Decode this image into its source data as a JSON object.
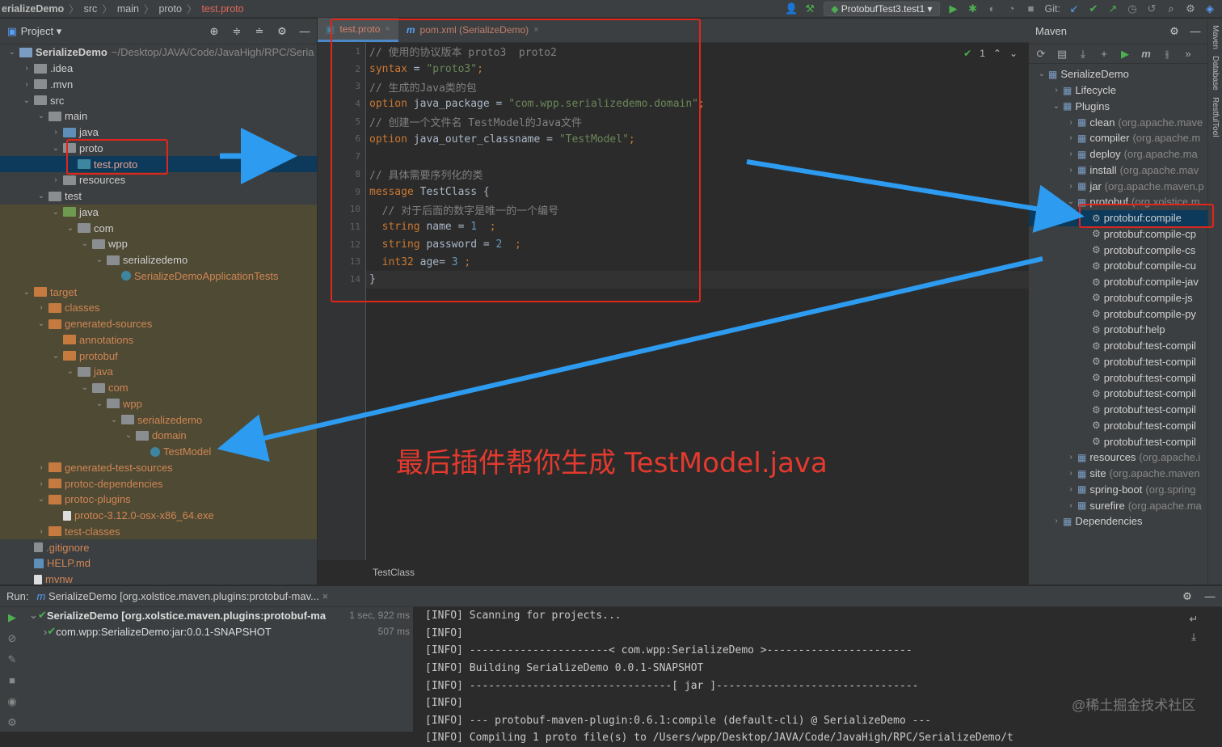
{
  "toolbar": {
    "breadcrumbs": [
      "erializeDemo",
      "src",
      "main",
      "proto",
      "test.proto"
    ],
    "run_config": "ProtobufTest3.test1",
    "git_label": "Git:"
  },
  "project": {
    "title": "Project",
    "root_path": "~/Desktop/JAVA/Code/JavaHigh/RPC/Seria",
    "items": [
      {
        "label": "SerializeDemo",
        "depth": 0,
        "arrow": "v",
        "icon": "module",
        "bold": true
      },
      {
        "label": ".idea",
        "depth": 1,
        "arrow": ">",
        "icon": "folder"
      },
      {
        "label": ".mvn",
        "depth": 1,
        "arrow": ">",
        "icon": "folder"
      },
      {
        "label": "src",
        "depth": 1,
        "arrow": "v",
        "icon": "folder"
      },
      {
        "label": "main",
        "depth": 2,
        "arrow": "v",
        "icon": "folder"
      },
      {
        "label": "java",
        "depth": 3,
        "arrow": ">",
        "icon": "folder-b"
      },
      {
        "label": "proto",
        "depth": 3,
        "arrow": "v",
        "icon": "folder"
      },
      {
        "label": "test.proto",
        "depth": 4,
        "arrow": "",
        "icon": "proto",
        "selected": true,
        "orange": true
      },
      {
        "label": "resources",
        "depth": 3,
        "arrow": ">",
        "icon": "folder"
      },
      {
        "label": "test",
        "depth": 2,
        "arrow": "v",
        "icon": "folder"
      },
      {
        "label": "java",
        "depth": 3,
        "arrow": "v",
        "icon": "folder-g",
        "hl": true
      },
      {
        "label": "com",
        "depth": 4,
        "arrow": "v",
        "icon": "folder",
        "hl": true
      },
      {
        "label": "wpp",
        "depth": 5,
        "arrow": "v",
        "icon": "folder",
        "hl": true
      },
      {
        "label": "serializedemo",
        "depth": 6,
        "arrow": "v",
        "icon": "folder",
        "hl": true
      },
      {
        "label": "SerializeDemoApplicationTests",
        "depth": 7,
        "arrow": "",
        "icon": "class",
        "orange": true,
        "hl": true
      },
      {
        "label": "target",
        "depth": 1,
        "arrow": "v",
        "icon": "folder-o",
        "orange": true,
        "hl": true
      },
      {
        "label": "classes",
        "depth": 2,
        "arrow": ">",
        "icon": "folder-o",
        "orange": true,
        "hl": true
      },
      {
        "label": "generated-sources",
        "depth": 2,
        "arrow": "v",
        "icon": "folder-o",
        "orange": true,
        "hl": true
      },
      {
        "label": "annotations",
        "depth": 3,
        "arrow": "",
        "icon": "folder-o",
        "orange": true,
        "hl": true
      },
      {
        "label": "protobuf",
        "depth": 3,
        "arrow": "v",
        "icon": "folder-o",
        "orange": true,
        "hl": true
      },
      {
        "label": "java",
        "depth": 4,
        "arrow": "v",
        "icon": "folder",
        "orange": true,
        "hl": true
      },
      {
        "label": "com",
        "depth": 5,
        "arrow": "v",
        "icon": "folder",
        "orange": true,
        "hl": true
      },
      {
        "label": "wpp",
        "depth": 6,
        "arrow": "v",
        "icon": "folder",
        "orange": true,
        "hl": true
      },
      {
        "label": "serializedemo",
        "depth": 7,
        "arrow": "v",
        "icon": "folder",
        "orange": true,
        "hl": true
      },
      {
        "label": "domain",
        "depth": 8,
        "arrow": "v",
        "icon": "folder",
        "orange": true,
        "hl": true
      },
      {
        "label": "TestModel",
        "depth": 9,
        "arrow": "",
        "icon": "class",
        "orange": true,
        "hl": true
      },
      {
        "label": "generated-test-sources",
        "depth": 2,
        "arrow": ">",
        "icon": "folder-o",
        "orange": true,
        "hl": true
      },
      {
        "label": "protoc-dependencies",
        "depth": 2,
        "arrow": ">",
        "icon": "folder-o",
        "orange": true,
        "hl": true
      },
      {
        "label": "protoc-plugins",
        "depth": 2,
        "arrow": "v",
        "icon": "folder-o",
        "orange": true,
        "hl": true
      },
      {
        "label": "protoc-3.12.0-osx-x86_64.exe",
        "depth": 3,
        "arrow": "",
        "icon": "file",
        "orange": true,
        "hl": true
      },
      {
        "label": "test-classes",
        "depth": 2,
        "arrow": ">",
        "icon": "folder-o",
        "orange": true,
        "hl": true
      },
      {
        "label": ".gitignore",
        "depth": 1,
        "arrow": "",
        "icon": "git",
        "orange": true
      },
      {
        "label": "HELP.md",
        "depth": 1,
        "arrow": "",
        "icon": "md",
        "orange": true
      },
      {
        "label": "mvnw",
        "depth": 1,
        "arrow": "",
        "icon": "file",
        "orange": true
      }
    ]
  },
  "editor": {
    "tabs": [
      {
        "label": "test.proto",
        "active": true
      },
      {
        "label": "pom.xml (SerializeDemo)",
        "active": false
      }
    ],
    "inspection": "1",
    "line_numbers": [
      "1",
      "2",
      "3",
      "4",
      "5",
      "6",
      "7",
      "8",
      "9",
      "10",
      "11",
      "12",
      "13",
      "14"
    ],
    "code": [
      [
        {
          "t": "// 使用的协议版本 proto3  proto2",
          "c": "cm"
        }
      ],
      [
        {
          "t": "syntax",
          "c": "kw"
        },
        {
          "t": " = ",
          "c": "tx"
        },
        {
          "t": "\"proto3\"",
          "c": "st"
        },
        {
          "t": ";",
          "c": "kw"
        }
      ],
      [
        {
          "t": "// 生成的Java类的包",
          "c": "cm"
        }
      ],
      [
        {
          "t": "option",
          "c": "kw"
        },
        {
          "t": " java_package = ",
          "c": "tx"
        },
        {
          "t": "\"com.wpp.serializedemo.domain\"",
          "c": "st"
        },
        {
          "t": ";",
          "c": "kw"
        }
      ],
      [
        {
          "t": "// 创建一个文件名 TestModel的Java文件",
          "c": "cm"
        }
      ],
      [
        {
          "t": "option",
          "c": "kw"
        },
        {
          "t": " java_outer_classname = ",
          "c": "tx"
        },
        {
          "t": "\"TestModel\"",
          "c": "st"
        },
        {
          "t": ";",
          "c": "kw"
        }
      ],
      [
        {
          "t": "",
          "c": "tx"
        }
      ],
      [
        {
          "t": "// 具体需要序列化的类",
          "c": "cm"
        }
      ],
      [
        {
          "t": "message",
          "c": "kw"
        },
        {
          "t": " TestClass {",
          "c": "tx"
        }
      ],
      [
        {
          "t": "  // 对于后面的数字是唯一的一个编号",
          "c": "cm"
        }
      ],
      [
        {
          "t": "  string",
          "c": "kw"
        },
        {
          "t": " name = ",
          "c": "tx"
        },
        {
          "t": "1",
          "c": "nu"
        },
        {
          "t": "  ;",
          "c": "kw"
        }
      ],
      [
        {
          "t": "  string",
          "c": "kw"
        },
        {
          "t": " password = ",
          "c": "tx"
        },
        {
          "t": "2",
          "c": "nu"
        },
        {
          "t": "  ;",
          "c": "kw"
        }
      ],
      [
        {
          "t": "  int32",
          "c": "kw"
        },
        {
          "t": " age= ",
          "c": "tx"
        },
        {
          "t": "3",
          "c": "nu"
        },
        {
          "t": " ;",
          "c": "kw"
        }
      ],
      [
        {
          "t": "}",
          "c": "tx"
        }
      ]
    ],
    "breadcrumb": "TestClass"
  },
  "maven": {
    "title": "Maven",
    "items": [
      {
        "label": "SerializeDemo",
        "depth": 0,
        "arrow": "v",
        "sub": ""
      },
      {
        "label": "Lifecycle",
        "depth": 1,
        "arrow": ">",
        "sub": ""
      },
      {
        "label": "Plugins",
        "depth": 1,
        "arrow": "v",
        "sub": ""
      },
      {
        "label": "clean",
        "depth": 2,
        "arrow": ">",
        "sub": "(org.apache.mave"
      },
      {
        "label": "compiler",
        "depth": 2,
        "arrow": ">",
        "sub": "(org.apache.m"
      },
      {
        "label": "deploy",
        "depth": 2,
        "arrow": ">",
        "sub": "(org.apache.ma"
      },
      {
        "label": "install",
        "depth": 2,
        "arrow": ">",
        "sub": "(org.apache.mav"
      },
      {
        "label": "jar",
        "depth": 2,
        "arrow": ">",
        "sub": "(org.apache.maven.p"
      },
      {
        "label": "protobuf",
        "depth": 2,
        "arrow": "v",
        "sub": "(org.xolstice.m"
      },
      {
        "label": "protobuf:compile",
        "depth": 3,
        "arrow": "",
        "sub": "",
        "selected": true,
        "goal": true
      },
      {
        "label": "protobuf:compile-cp",
        "depth": 3,
        "arrow": "",
        "sub": "",
        "goal": true
      },
      {
        "label": "protobuf:compile-cs",
        "depth": 3,
        "arrow": "",
        "sub": "",
        "goal": true
      },
      {
        "label": "protobuf:compile-cu",
        "depth": 3,
        "arrow": "",
        "sub": "",
        "goal": true
      },
      {
        "label": "protobuf:compile-jav",
        "depth": 3,
        "arrow": "",
        "sub": "",
        "goal": true
      },
      {
        "label": "protobuf:compile-js",
        "depth": 3,
        "arrow": "",
        "sub": "",
        "goal": true
      },
      {
        "label": "protobuf:compile-py",
        "depth": 3,
        "arrow": "",
        "sub": "",
        "goal": true
      },
      {
        "label": "protobuf:help",
        "depth": 3,
        "arrow": "",
        "sub": "",
        "goal": true
      },
      {
        "label": "protobuf:test-compil",
        "depth": 3,
        "arrow": "",
        "sub": "",
        "goal": true
      },
      {
        "label": "protobuf:test-compil",
        "depth": 3,
        "arrow": "",
        "sub": "",
        "goal": true
      },
      {
        "label": "protobuf:test-compil",
        "depth": 3,
        "arrow": "",
        "sub": "",
        "goal": true
      },
      {
        "label": "protobuf:test-compil",
        "depth": 3,
        "arrow": "",
        "sub": "",
        "goal": true
      },
      {
        "label": "protobuf:test-compil",
        "depth": 3,
        "arrow": "",
        "sub": "",
        "goal": true
      },
      {
        "label": "protobuf:test-compil",
        "depth": 3,
        "arrow": "",
        "sub": "",
        "goal": true
      },
      {
        "label": "protobuf:test-compil",
        "depth": 3,
        "arrow": "",
        "sub": "",
        "goal": true
      },
      {
        "label": "resources",
        "depth": 2,
        "arrow": ">",
        "sub": "(org.apache.i"
      },
      {
        "label": "site",
        "depth": 2,
        "arrow": ">",
        "sub": "(org.apache.maven"
      },
      {
        "label": "spring-boot",
        "depth": 2,
        "arrow": ">",
        "sub": "(org.spring"
      },
      {
        "label": "surefire",
        "depth": 2,
        "arrow": ">",
        "sub": "(org.apache.ma"
      },
      {
        "label": "Dependencies",
        "depth": 1,
        "arrow": ">",
        "sub": ""
      }
    ]
  },
  "side_stripe": [
    "Maven",
    "Database",
    "RestfulTool"
  ],
  "run": {
    "label": "Run:",
    "tab": "SerializeDemo [org.xolstice.maven.plugins:protobuf-mav...",
    "tree": [
      {
        "label": "SerializeDemo [org.xolstice.maven.plugins:protobuf-ma",
        "time": "1 sec, 922 ms",
        "depth": 0,
        "bold": true
      },
      {
        "label": "com.wpp:SerializeDemo:jar:0.0.1-SNAPSHOT",
        "time": "507 ms",
        "depth": 1,
        "bold": false
      }
    ],
    "console": [
      "[INFO] Scanning for projects...",
      "[INFO]",
      "[INFO] ----------------------< com.wpp:SerializeDemo >-----------------------",
      "[INFO] Building SerializeDemo 0.0.1-SNAPSHOT",
      "[INFO] --------------------------------[ jar ]--------------------------------",
      "[INFO]",
      "[INFO] --- protobuf-maven-plugin:0.6.1:compile (default-cli) @ SerializeDemo ---",
      "[INFO] Compiling 1 proto file(s) to /Users/wpp/Desktop/JAVA/Code/JavaHigh/RPC/SerializeDemo/t"
    ]
  },
  "annotation": {
    "caption": "最后插件帮你生成 TestModel.java",
    "watermark": "@稀土掘金技术社区",
    "arrow_color": "#2d9bf0",
    "box_color": "#e0261c"
  }
}
